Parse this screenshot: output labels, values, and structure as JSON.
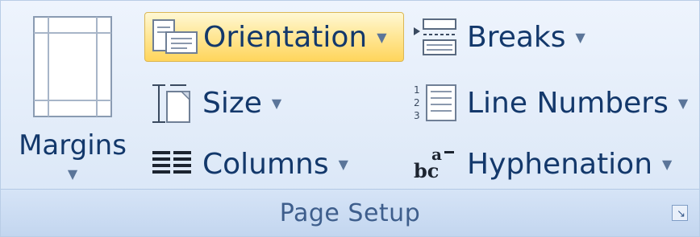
{
  "group": {
    "title": "Page Setup",
    "launcher_icon": "dialog-launcher-icon",
    "launcher_glyph": "↘"
  },
  "margins": {
    "label": "Margins",
    "icon": "margins-icon",
    "arrow": "▼"
  },
  "orientation": {
    "label": "Orientation",
    "icon": "orientation-icon",
    "arrow": "▼",
    "state": "hover"
  },
  "size": {
    "label": "Size",
    "icon": "size-icon",
    "arrow": "▼"
  },
  "columns": {
    "label": "Columns",
    "icon": "columns-icon",
    "arrow": "▼"
  },
  "breaks": {
    "label": "Breaks",
    "icon": "breaks-icon",
    "arrow": "▼"
  },
  "line_numbers": {
    "label": "Line Numbers",
    "icon": "line-numbers-icon",
    "arrow": "▼"
  },
  "hyphenation": {
    "label": "Hyphenation",
    "icon": "hyphenation-icon",
    "arrow": "▼",
    "icon_glyph_top": "a",
    "icon_glyph_bottom": "bc"
  },
  "colors": {
    "text": "#13386b",
    "hover_top": "#fff8d4",
    "hover_bottom": "#ffd55c",
    "group_bg": "#e2ecf9"
  }
}
